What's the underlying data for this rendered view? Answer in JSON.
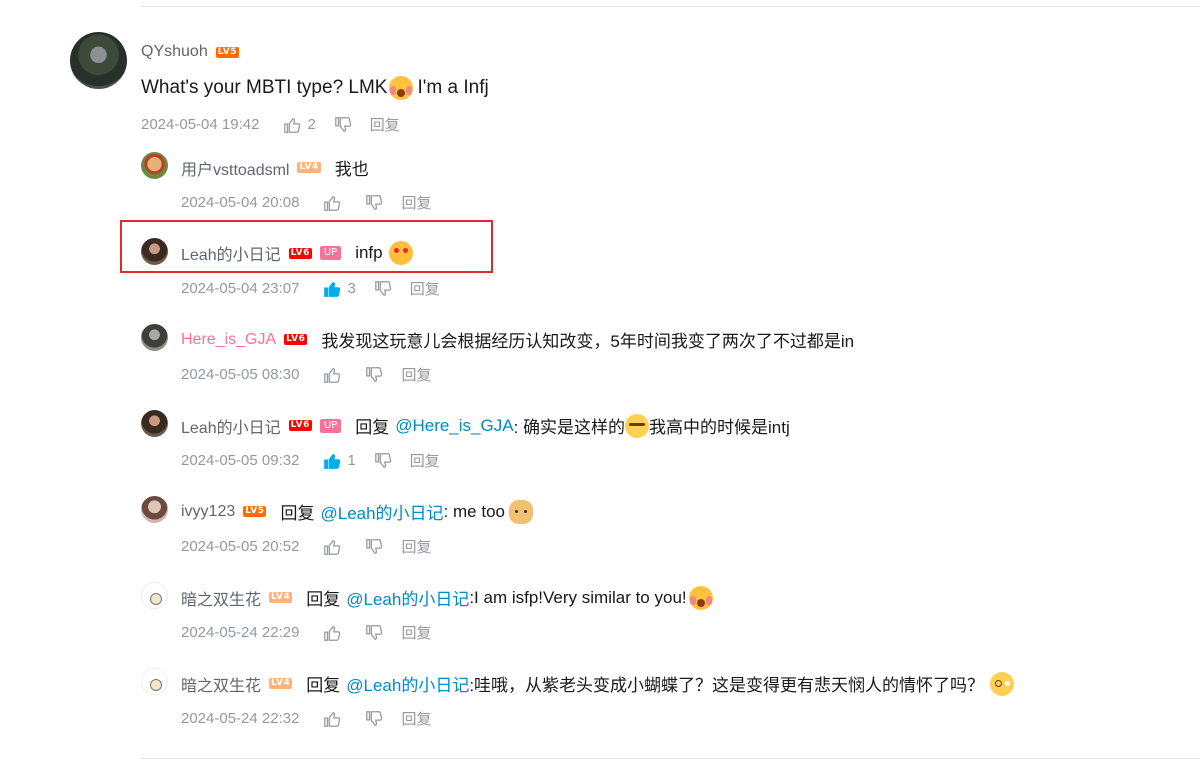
{
  "main_comment": {
    "username": "QYshuoh",
    "level": "LV5",
    "text": "What's your MBTI type? LMK",
    "text_after": "I'm a Infj",
    "emoji": "shocked-face-emoji",
    "time": "2024-05-04 19:42",
    "likes": "2",
    "reply_label": "回复"
  },
  "replies": [
    {
      "username": "用户vsttoadsml",
      "level": "LV4",
      "text": "我也",
      "time": "2024-05-04 20:08",
      "likes": "",
      "reply_label": "回复"
    },
    {
      "username": "Leah的小日记",
      "level": "LV6",
      "up_badge": "UP",
      "text": "infp",
      "emoji": "love-face-emoji",
      "time": "2024-05-04 23:07",
      "likes": "3",
      "reply_label": "回复",
      "highlighted": true
    },
    {
      "username": "Here_is_GJA",
      "level": "LV6",
      "text": "我发现这玩意儿会根据经历认知改变，5年时间我变了两次了不过都是in",
      "time": "2024-05-05 08:30",
      "likes": "",
      "reply_label": "回复"
    },
    {
      "username": "Leah的小日记",
      "level": "LV6",
      "up_badge": "UP",
      "reply_word": "回复",
      "mention": "@Here_is_GJA",
      "text_before": ": 确实是这样的",
      "text_after": "我高中的时候是intj",
      "emoji": "tearful-laugh-emoji",
      "time": "2024-05-05 09:32",
      "likes": "1",
      "reply_label": "回复"
    },
    {
      "username": "ivyy123",
      "level": "LV5",
      "reply_word": "回复",
      "mention": "@Leah的小日记",
      "text_before": ": me too",
      "emoji": "doge-emoji",
      "time": "2024-05-05 20:52",
      "likes": "",
      "reply_label": "回复"
    },
    {
      "username": "暗之双生花",
      "level": "LV4",
      "reply_word": "回复",
      "mention": "@Leah的小日记",
      "text_before": ":I am isfp!Very similar to you!",
      "emoji": "shocked-face-emoji",
      "time": "2024-05-24 22:29",
      "likes": "",
      "reply_label": "回复"
    },
    {
      "username": "暗之双生花",
      "level": "LV4",
      "reply_word": "回复",
      "mention": "@Leah的小日记",
      "text_before": ":哇哦，从紫老头变成小蝴蝶了？这是变得更有悲天悯人的情怀了吗？",
      "emoji": "blushing-face-emoji",
      "time": "2024-05-24 22:32",
      "likes": "",
      "reply_label": "回复"
    }
  ],
  "colors": {
    "accent_blue": "#00aeec",
    "mention_blue": "#008ac5",
    "up_pink": "#fb7299",
    "highlight_red": "#e02b2b",
    "meta_gray": "#9499a0"
  }
}
